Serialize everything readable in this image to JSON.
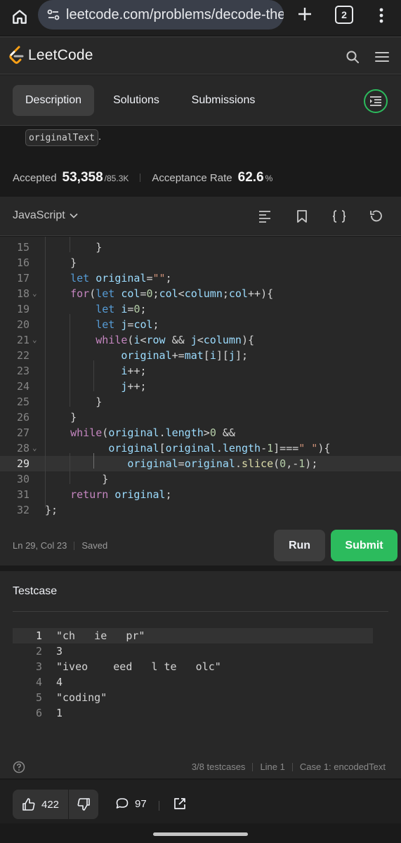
{
  "browser": {
    "url": "leetcode.com/problems/decode-the-s",
    "tab_count": "2"
  },
  "header": {
    "logo_text": "LeetCode"
  },
  "tabs": [
    {
      "label": "Description",
      "active": true
    },
    {
      "label": "Solutions",
      "active": false
    },
    {
      "label": "Submissions",
      "active": false
    }
  ],
  "description": {
    "code_chip": "originalText",
    "trailing": "."
  },
  "stats": {
    "accepted_label": "Accepted",
    "accepted_value": "53,358",
    "accepted_total": "/85.3K",
    "rate_label": "Acceptance Rate",
    "rate_value": "62.6",
    "rate_unit": "%"
  },
  "editor": {
    "language": "JavaScript",
    "status_position": "Ln 29, Col 23",
    "status_saved": "Saved",
    "current_line": "29",
    "lines": [
      {
        "n": "15",
        "text": "        }"
      },
      {
        "n": "16",
        "text": "    }"
      },
      {
        "n": "17",
        "text": "    let original=\"\";"
      },
      {
        "n": "18",
        "text": "    for(let col=0;col<column;col++){"
      },
      {
        "n": "19",
        "text": "        let i=0;"
      },
      {
        "n": "20",
        "text": "        let j=col;"
      },
      {
        "n": "21",
        "text": "        while(i<row && j<column){"
      },
      {
        "n": "22",
        "text": "            original+=mat[i][j];"
      },
      {
        "n": "23",
        "text": "            i++;"
      },
      {
        "n": "24",
        "text": "            j++;"
      },
      {
        "n": "25",
        "text": "        }"
      },
      {
        "n": "26",
        "text": "    }"
      },
      {
        "n": "27",
        "text": "    while(original.length>0 &&"
      },
      {
        "n": "28",
        "text": "          original[original.length-1]===\" \"){"
      },
      {
        "n": "29",
        "text": "             original=original.slice(0,-1);"
      },
      {
        "n": "30",
        "text": "         }"
      },
      {
        "n": "31",
        "text": "    return original;"
      },
      {
        "n": "32",
        "text": "};"
      }
    ]
  },
  "buttons": {
    "run": "Run",
    "submit": "Submit"
  },
  "testcase": {
    "title": "Testcase",
    "lines": [
      {
        "n": "1",
        "text": "\"ch   ie   pr\""
      },
      {
        "n": "2",
        "text": "3"
      },
      {
        "n": "3",
        "text": "\"iveo    eed   l te   olc\""
      },
      {
        "n": "4",
        "text": "4"
      },
      {
        "n": "5",
        "text": "\"coding\""
      },
      {
        "n": "6",
        "text": "1"
      }
    ],
    "footer_count": "3/8 testcases",
    "footer_line": "Line 1",
    "footer_case": "Case 1: encodedText"
  },
  "actions": {
    "upvotes": "422",
    "comments": "97"
  },
  "colors": {
    "accent_green": "#2cbb5d",
    "keyword_blue": "#569cd6",
    "keyword_purple": "#c586c0",
    "variable": "#9cdcfe",
    "number": "#b5cea8",
    "string": "#ce9178"
  },
  "icons": [
    "home-icon",
    "site-settings-icon",
    "new-tab-icon",
    "tab-switcher-icon",
    "more-vert-icon",
    "leetcode-logo-icon",
    "search-icon",
    "hamburger-menu-icon",
    "panel-toggle-icon",
    "chevron-down-icon",
    "format-code-icon",
    "bookmark-icon",
    "braces-icon",
    "reset-icon",
    "help-icon",
    "thumbs-up-icon",
    "thumbs-down-icon",
    "comment-icon",
    "share-icon"
  ]
}
